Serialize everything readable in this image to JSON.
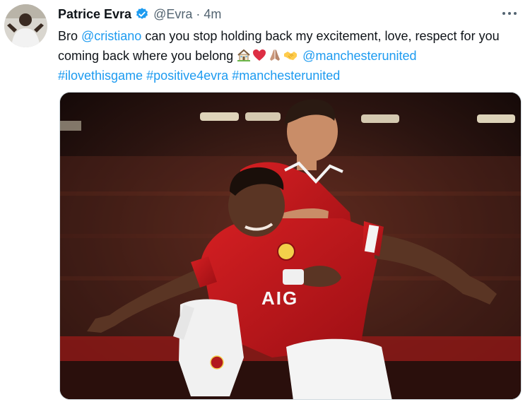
{
  "tweet": {
    "author_name": "Patrice Evra",
    "handle": "@Evra",
    "separator": "·",
    "time": "4m",
    "text": {
      "part1": "Bro ",
      "mention1": "@cristiano",
      "part2": " can you stop holding back my excitement, love, respect for you coming back where you belong ",
      "mention2": "@manchesterunited",
      "hashtags": [
        "#ilovethisgame",
        "#positive4evra",
        "#manchesterunited"
      ]
    },
    "emojis": [
      "house-emoji",
      "red-heart-emoji",
      "folded-hands-emoji",
      "handshake-emoji"
    ],
    "shirt_sponsor": "AIG"
  },
  "icons": {
    "verified": "verified-badge-icon",
    "more": "more-options-icon"
  },
  "colors": {
    "link": "#1d9bf0",
    "verified": "#1d9bf0",
    "text": "#0f1419",
    "secondary": "#536471",
    "shirt_red": "#c0161c"
  }
}
